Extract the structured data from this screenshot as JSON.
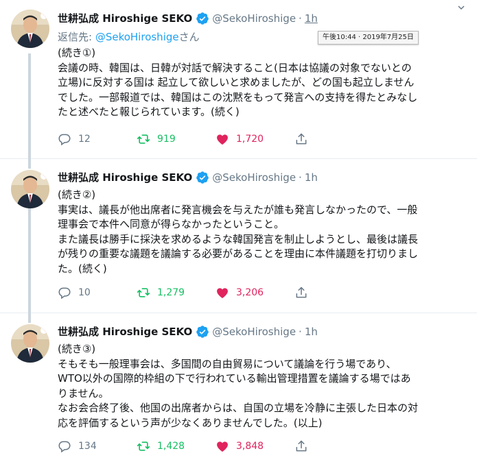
{
  "tooltip": "午後10:44 · 2019年7月25日",
  "tweets": [
    {
      "name": "世耕弘成 Hiroshige SEKO",
      "handle": "@SekoHiroshige",
      "dot": "·",
      "time": "1h",
      "replying_prefix": "返信先: ",
      "replying_to": "@SekoHiroshige",
      "replying_suffix": "さん",
      "lines": [
        "(続き①)",
        "会議の時、韓国は、日韓が対話で解決すること(日本は協議の対象でないとの",
        "立場)に反対する国は 起立して欲しいと求めましたが、どの国も起立しません",
        "でした。一部報道では、韓国はこの沈黙をもって発言への支持を得たとみなし",
        "たと述べたと報じられています。(続く)"
      ],
      "replies": "12",
      "retweets": "919",
      "likes": "1,720"
    },
    {
      "name": "世耕弘成 Hiroshige SEKO",
      "handle": "@SekoHiroshige",
      "dot": "·",
      "time": "1h",
      "lines": [
        "(続き②)",
        "事実は、議長が他出席者に発言機会を与えたが誰も発言しなかったので、一般",
        "理事会で本件へ同意が得らなかったということ。",
        "また議長は勝手に採決を求めるような韓国発言を制止しようとし、最後は議長",
        "が残りの重要な議題を議論する必要があることを理由に本件議題を打切りまし",
        "た。(続く)"
      ],
      "replies": "10",
      "retweets": "1,279",
      "likes": "3,206"
    },
    {
      "name": "世耕弘成 Hiroshige SEKO",
      "handle": "@SekoHiroshige",
      "dot": "·",
      "time": "1h",
      "lines": [
        "(続き③)",
        "そもそも一般理事会は、多国間の自由貿易について議論を行う場であり、",
        "WTO以外の国際的枠組の下で行われている輸出管理措置を議論する場ではあ",
        "りません。",
        "なお会合終了後、他国の出席者からは、自国の立場を冷静に主張した日本の対",
        "応を評価するという声が少なくありませんでした。(以上)"
      ],
      "replies": "134",
      "retweets": "1,428",
      "likes": "3,848"
    }
  ],
  "colors": {
    "verified": "#1da1f2",
    "link": "#1da1f2",
    "retweet": "#17bf63",
    "like": "#e0245e",
    "muted": "#657786"
  },
  "icons": [
    "verified-badge-icon",
    "reply-icon",
    "retweet-icon",
    "heart-icon",
    "share-icon",
    "chevron-down-icon"
  ]
}
